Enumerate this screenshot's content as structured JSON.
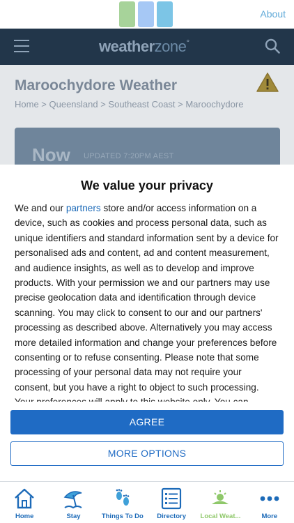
{
  "appbar": {
    "about_label": "About",
    "swatch_colors": [
      "#a7d39a",
      "#a6c8f5",
      "#7cc5e6"
    ]
  },
  "site": {
    "logo_weather": "weather",
    "logo_zone": "zone",
    "page_title": "Maroochydore Weather",
    "breadcrumb": "Home > Queensland > Southeast Coast > Maroochydore",
    "now_label": "Now",
    "now_updated": "UPDATED 7:20PM AEST"
  },
  "consent": {
    "title": "We value your privacy",
    "body_prefix": "We and our ",
    "partners_link": "partners",
    "body_rest": " store and/or access information on a device, such as cookies and process personal data, such as unique identifiers and standard information sent by a device for personalised ads and content, ad and content measurement, and audience insights, as well as to develop and improve products. With your permission we and our partners may use precise geolocation data and identification through device scanning. You may click to consent to our and our partners' processing as described above. Alternatively you may access more detailed information and change your preferences before consenting or to refuse consenting. Please note that some processing of your personal data may not require your consent, but you have a right to object to such processing. Your preferences will apply to this website only. You can change your",
    "agree_label": "AGREE",
    "more_options_label": "MORE OPTIONS"
  },
  "tabs": [
    {
      "label": "Home",
      "icon": "home-icon"
    },
    {
      "label": "Stay",
      "icon": "beach-umbrella-icon"
    },
    {
      "label": "Things To Do",
      "icon": "footprints-icon"
    },
    {
      "label": "Directory",
      "icon": "directory-list-icon"
    },
    {
      "label": "Local Weat...",
      "icon": "local-weather-icon"
    },
    {
      "label": "More",
      "icon": "more-dots-icon"
    }
  ],
  "colors": {
    "accent": "#1f6bc4",
    "header": "#22364a",
    "local_weather_tab": "#8fc86a"
  }
}
